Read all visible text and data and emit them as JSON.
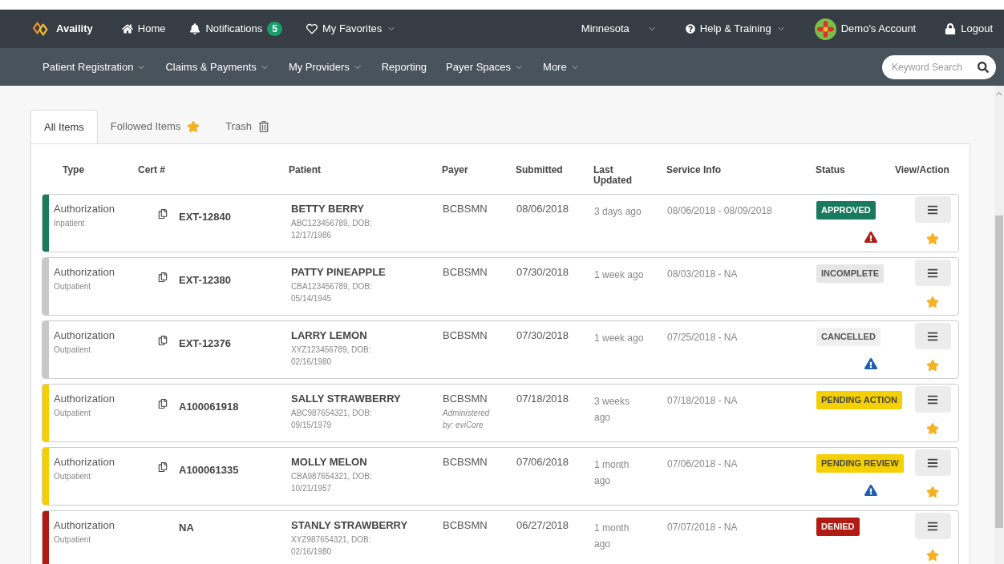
{
  "top_nav": {
    "logo": "Availity",
    "items": [
      {
        "kind": "home",
        "label": "Home",
        "dropdown": false
      },
      {
        "kind": "bell",
        "label": "Notifications",
        "badge": "5",
        "dropdown": false
      },
      {
        "kind": "heart",
        "label": "My Favorites",
        "dropdown": true
      }
    ],
    "right_items": [
      {
        "kind": "plain",
        "label": "Minnesota",
        "dropdown": true
      },
      {
        "kind": "help",
        "label": "Help & Training",
        "dropdown": true
      },
      {
        "kind": "avatar",
        "label": "Demo's Account",
        "dropdown": false
      },
      {
        "kind": "lock",
        "label": "Logout",
        "dropdown": false
      }
    ]
  },
  "sub_nav": {
    "items": [
      {
        "label": "Patient Registration",
        "dropdown": true
      },
      {
        "label": "Claims & Payments",
        "dropdown": true
      },
      {
        "label": "My Providers",
        "dropdown": true
      },
      {
        "label": "Reporting",
        "dropdown": false
      },
      {
        "label": "Payer Spaces",
        "dropdown": true
      },
      {
        "label": "More",
        "dropdown": true
      }
    ],
    "search": {
      "placeholder": "Keyword Search"
    }
  },
  "tabs": [
    {
      "label": "All Items",
      "selected": true,
      "kind": "plain"
    },
    {
      "label": "Followed Items",
      "selected": false,
      "kind": "star"
    },
    {
      "label": "Trash",
      "selected": false,
      "kind": "trash"
    }
  ],
  "table": {
    "columns": [
      "Type",
      "Cert #",
      "Patient",
      "Payer",
      "Submitted",
      "Last Updated",
      "Service Info",
      "Status",
      "View/Action"
    ],
    "rows": [
      {
        "color": "#1a7a5e",
        "type": "Authorization",
        "setting": "Inpatient",
        "copy_icon": true,
        "cert": "EXT-12840",
        "patient": "BETTY BERRY",
        "patient_info": "ABC123456789, DOB: 12/17/1986",
        "payer": "BCBSMN",
        "submitted": "08/06/2018",
        "last_updated": "3 days ago",
        "service_info": "08/06/2018 - 08/09/2018",
        "status": {
          "label": "APPROVED",
          "kind": "approved"
        },
        "alert": {
          "kind": "error"
        },
        "followed": true
      },
      {
        "color": "#c8c8c8",
        "type": "Authorization",
        "setting": "Outpatient",
        "copy_icon": true,
        "cert": "EXT-12380",
        "patient": "PATTY PINEAPPLE",
        "patient_info": "CBA123456789, DOB: 05/14/1945",
        "payer": "BCBSMN",
        "submitted": "07/30/2018",
        "last_updated": "1 week ago",
        "service_info": "08/03/2018 - NA",
        "status": {
          "label": "INCOMPLETE",
          "kind": "incomplete"
        },
        "followed": true
      },
      {
        "color": "#c8c8c8",
        "type": "Authorization",
        "setting": "Outpatient",
        "copy_icon": true,
        "cert": "EXT-12376",
        "patient": "LARRY LEMON",
        "patient_info": "XYZ123456789, DOB: 02/16/1980",
        "payer": "BCBSMN",
        "submitted": "07/30/2018",
        "last_updated": "1 week ago",
        "service_info": "07/25/2018 - NA",
        "status": {
          "label": "CANCELLED",
          "kind": "cancelled"
        },
        "alert": {
          "kind": "info"
        },
        "followed": true
      },
      {
        "color": "#f5d000",
        "type": "Authorization",
        "setting": "Outpatient",
        "copy_icon": true,
        "cert": "A100061918",
        "patient": "SALLY STRAWBERRY",
        "patient_info": "ABC987654321, DOB: 09/15/1979",
        "payer": "BCBSMN",
        "payer_note": "Administered by: eviCore",
        "submitted": "07/18/2018",
        "last_updated": "3 weeks ago",
        "service_info": "07/18/2018 - NA",
        "status": {
          "label": "PENDING ACTION",
          "kind": "pending"
        },
        "followed": true
      },
      {
        "color": "#f5d000",
        "type": "Authorization",
        "setting": "Outpatient",
        "copy_icon": true,
        "cert": "A100061335",
        "patient": "MOLLY MELON",
        "patient_info": "CBA987654321, DOB: 10/21/1957",
        "payer": "BCBSMN",
        "submitted": "07/06/2018",
        "last_updated": "1 month ago",
        "service_info": "07/06/2018 - NA",
        "status": {
          "label": "PENDING REVIEW",
          "kind": "pending"
        },
        "alert": {
          "kind": "info"
        },
        "followed": true
      },
      {
        "color": "#b01c14",
        "type": "Authorization",
        "setting": "Outpatient",
        "copy_icon": false,
        "cert": "NA",
        "patient": "STANLY STRAWBERRY",
        "patient_info": "XYZ987654321, DOB: 02/16/1980",
        "payer": "BCBSMN",
        "submitted": "06/27/2018",
        "last_updated": "1 month ago",
        "service_info": "07/07/2018 - NA",
        "status": {
          "label": "DENIED",
          "kind": "denied"
        },
        "followed": true
      }
    ]
  }
}
